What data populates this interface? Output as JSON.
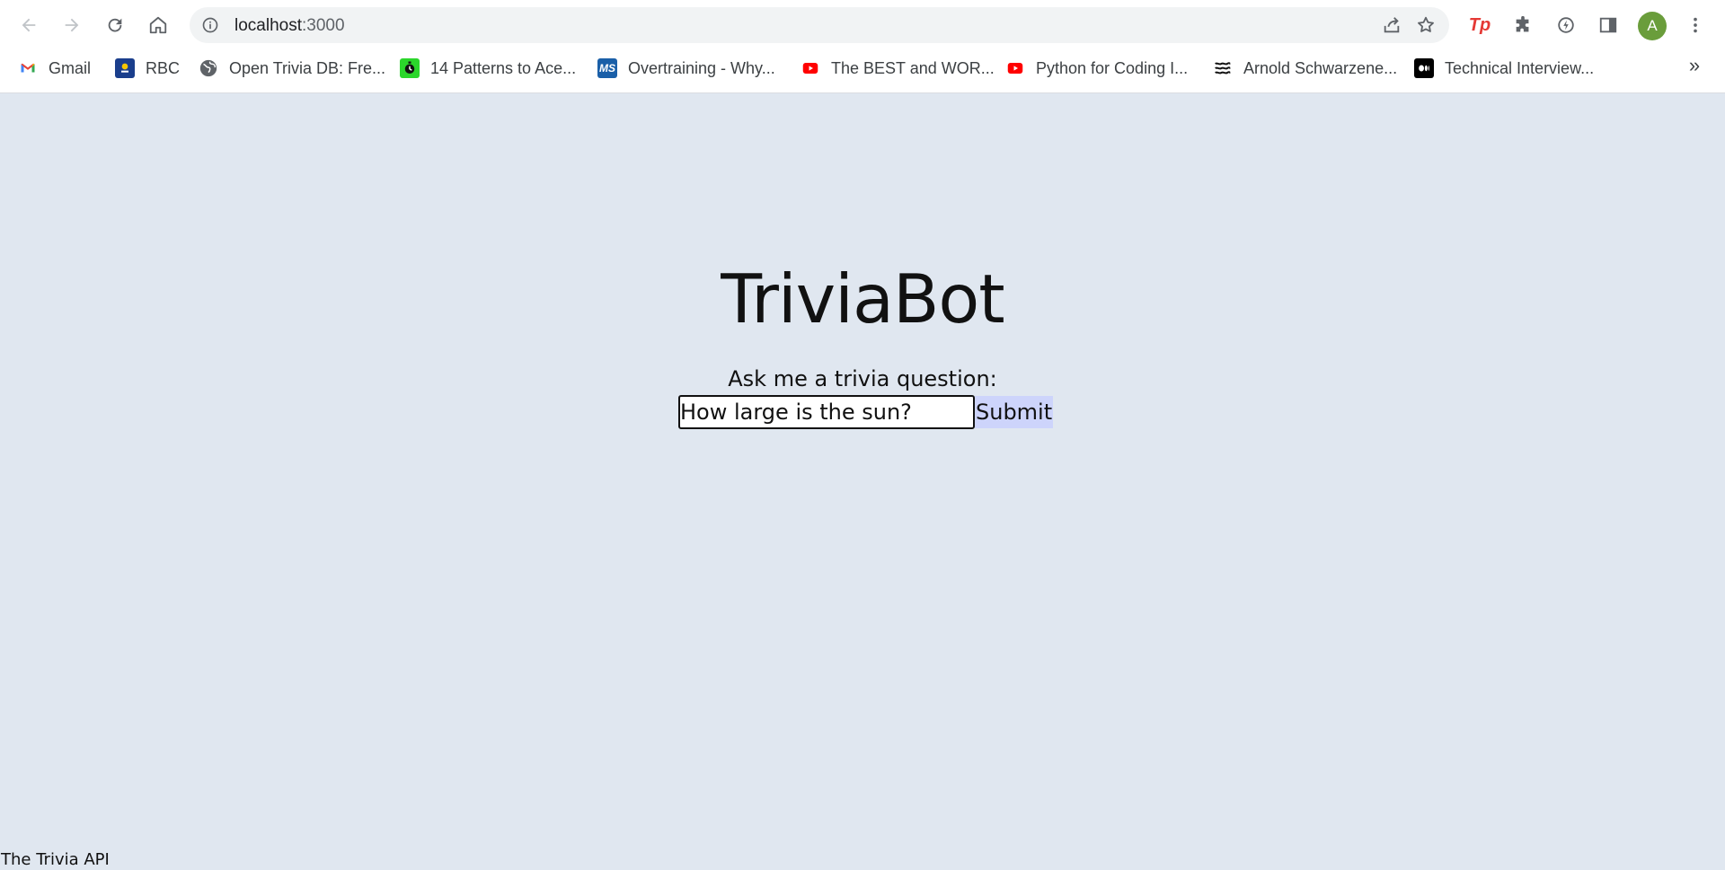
{
  "browser": {
    "url_host": "localhost",
    "url_port": ":3000",
    "avatar_letter": "A",
    "bookmarks": [
      {
        "label": "Gmail",
        "icon": "gmail-icon"
      },
      {
        "label": "RBC",
        "icon": "rbc-icon"
      },
      {
        "label": "Open Trivia DB: Fre...",
        "icon": "globe-icon"
      },
      {
        "label": "14 Patterns to Ace...",
        "icon": "timer-icon"
      },
      {
        "label": "Overtraining - Why...",
        "icon": "ms-icon"
      },
      {
        "label": "The BEST and WOR...",
        "icon": "youtube-icon"
      },
      {
        "label": "Python for Coding I...",
        "icon": "youtube-icon"
      },
      {
        "label": "Arnold Schwarzene...",
        "icon": "waves-icon"
      },
      {
        "label": "Technical Interview...",
        "icon": "medium-icon"
      }
    ],
    "more_bookmarks": "»"
  },
  "page": {
    "title": "TriviaBot",
    "prompt": "Ask me a trivia question:",
    "input_value": "How large is the sun?",
    "submit_label": "Submit",
    "footer": "The Trivia API"
  },
  "colors": {
    "page_bg": "#e0e7f0",
    "submit_bg": "#cdd4fb",
    "avatar": "#6a9d3b"
  }
}
